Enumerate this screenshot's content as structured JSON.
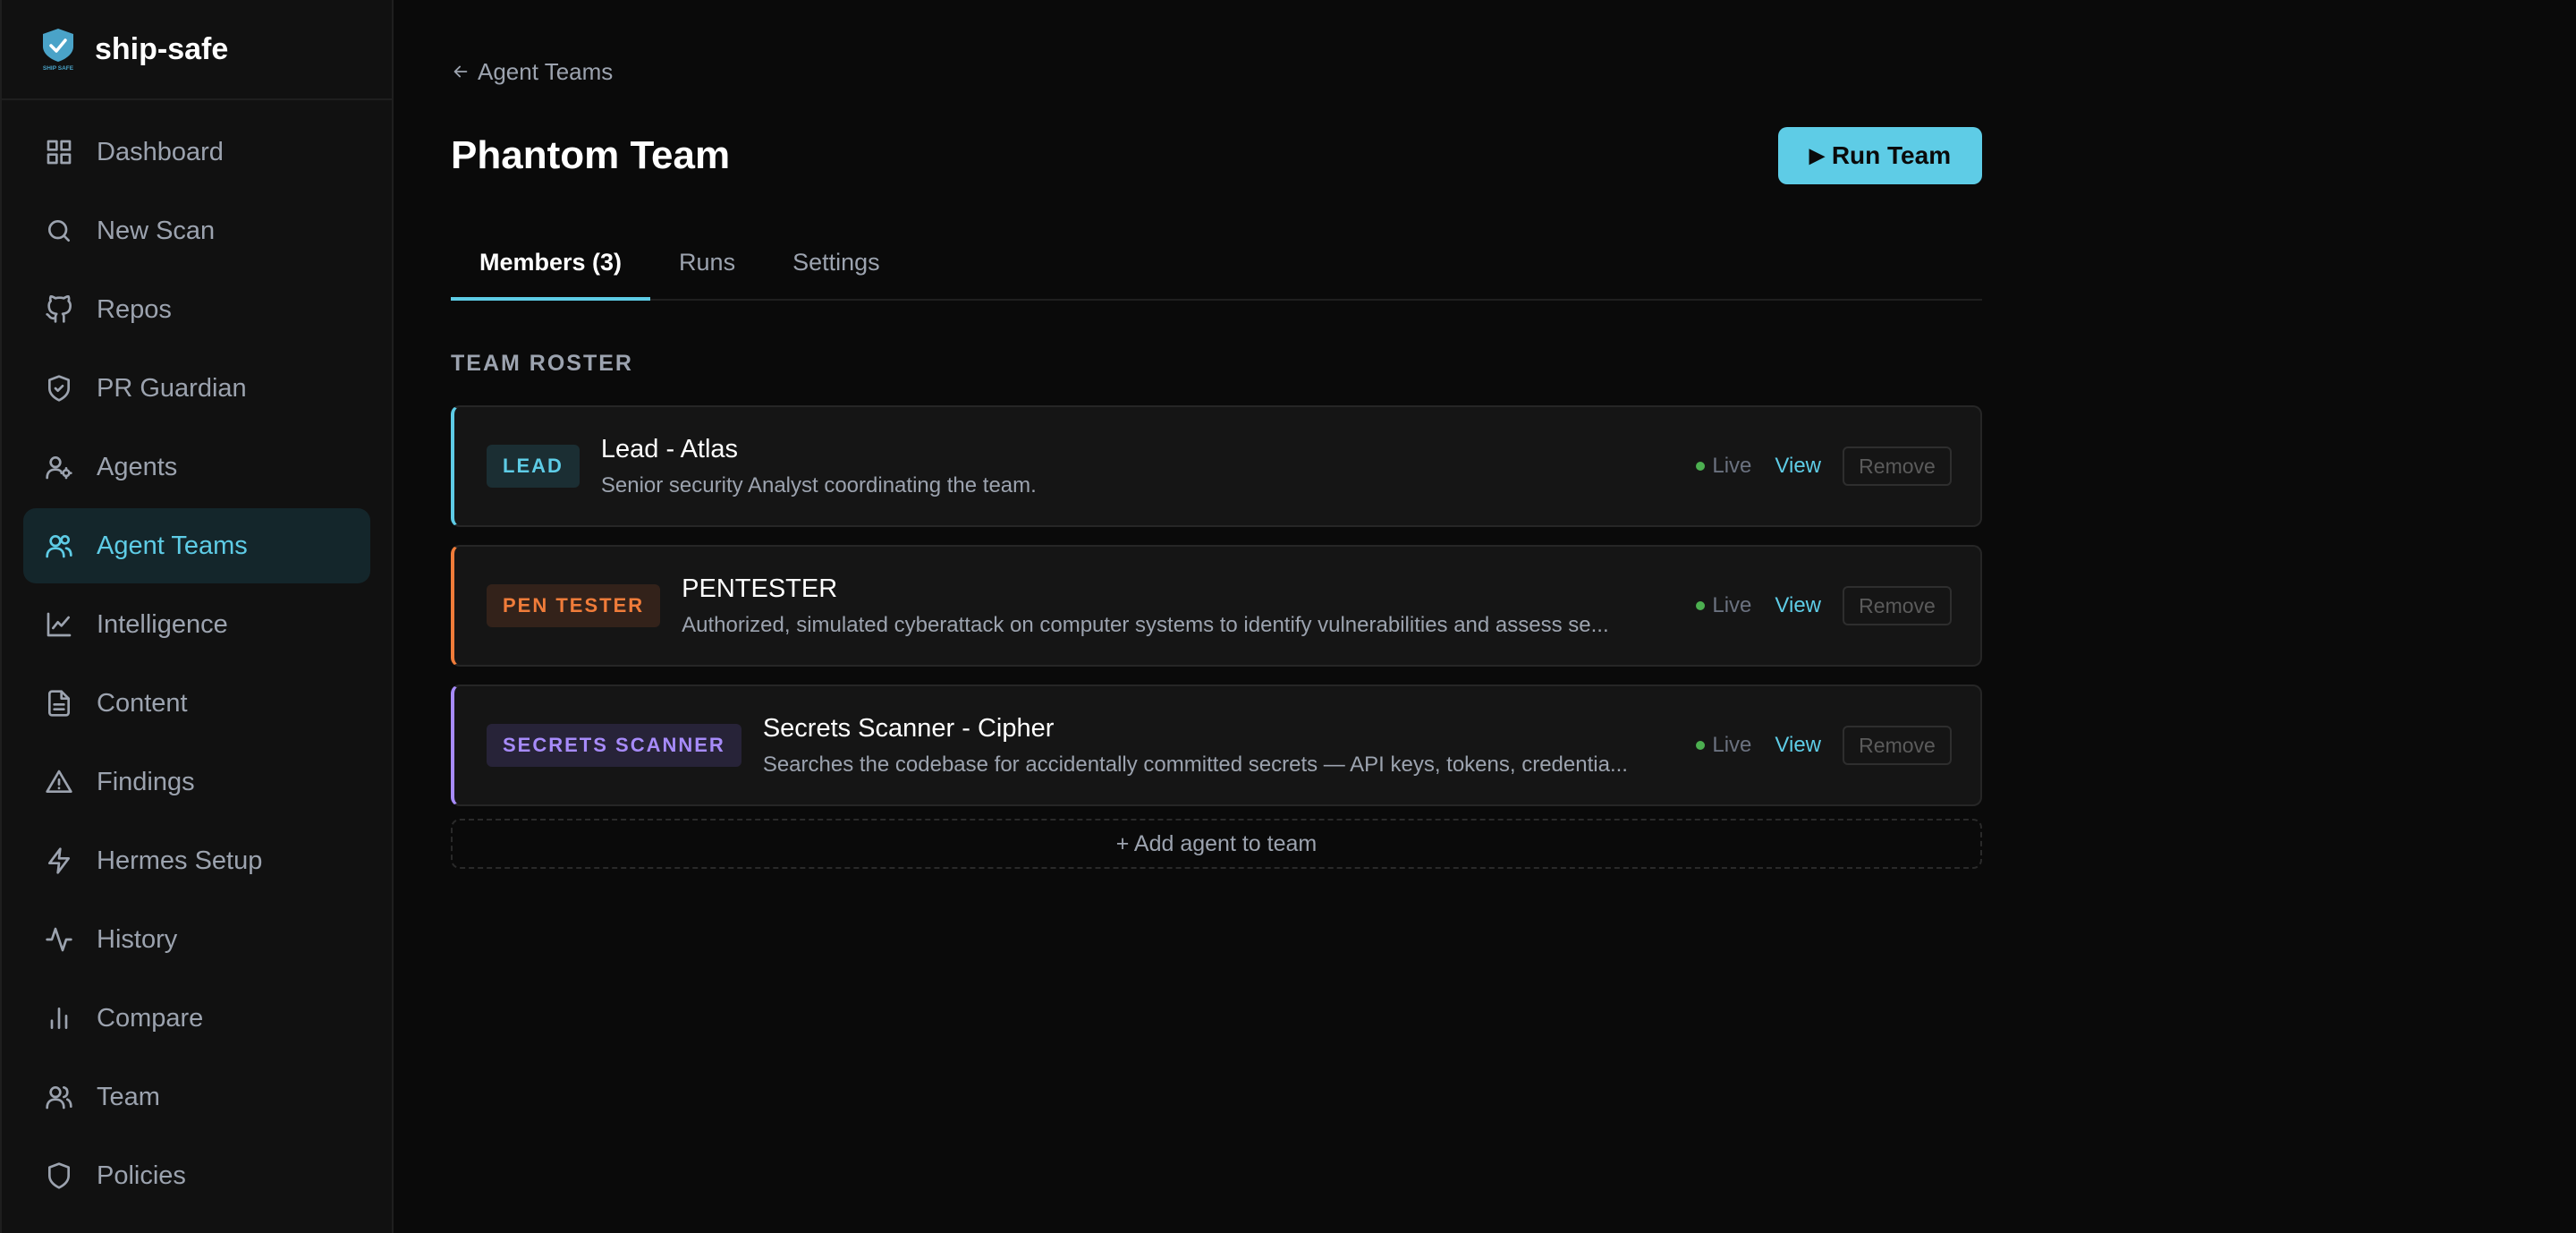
{
  "brand": {
    "name": "ship-safe",
    "logo_text": "SHIP SAFE",
    "accent": "#5ecce6"
  },
  "sidebar": {
    "items": [
      {
        "label": "Dashboard",
        "icon": "grid-icon",
        "active": false
      },
      {
        "label": "New Scan",
        "icon": "search-icon",
        "active": false
      },
      {
        "label": "Repos",
        "icon": "github-icon",
        "active": false
      },
      {
        "label": "PR Guardian",
        "icon": "shield-check-icon",
        "active": false
      },
      {
        "label": "Agents",
        "icon": "user-gear-icon",
        "active": false
      },
      {
        "label": "Agent Teams",
        "icon": "users-icon",
        "active": true
      },
      {
        "label": "Intelligence",
        "icon": "line-chart-icon",
        "active": false
      },
      {
        "label": "Content",
        "icon": "document-icon",
        "active": false
      },
      {
        "label": "Findings",
        "icon": "warning-icon",
        "active": false
      },
      {
        "label": "Hermes Setup",
        "icon": "lightning-icon",
        "active": false
      },
      {
        "label": "History",
        "icon": "activity-icon",
        "active": false
      },
      {
        "label": "Compare",
        "icon": "bar-chart-icon",
        "active": false
      },
      {
        "label": "Team",
        "icon": "team-icon",
        "active": false
      },
      {
        "label": "Policies",
        "icon": "shield-icon",
        "active": false
      }
    ]
  },
  "header": {
    "back_label": "Agent Teams",
    "title": "Phantom Team",
    "run_button": "Run Team",
    "run_icon": "▶"
  },
  "tabs": [
    {
      "label": "Members (3)",
      "active": true
    },
    {
      "label": "Runs",
      "active": false
    },
    {
      "label": "Settings",
      "active": false
    }
  ],
  "roster": {
    "section_label": "TEAM ROSTER",
    "members": [
      {
        "role": "LEAD",
        "role_color": "#5ecce6",
        "role_bg": "#1b2e33",
        "name": "Lead - Atlas",
        "description": "Senior security Analyst coordinating the team.",
        "status": "Live",
        "view_label": "View",
        "remove_label": "Remove"
      },
      {
        "role": "PEN TESTER",
        "role_color": "#f07c3a",
        "role_bg": "#33221a",
        "name": "PENTESTER",
        "description": "Authorized, simulated cyberattack on computer systems to identify vulnerabilities and assess se...",
        "status": "Live",
        "view_label": "View",
        "remove_label": "Remove"
      },
      {
        "role": "SECRETS SCANNER",
        "role_color": "#a78bfa",
        "role_bg": "#272338",
        "name": "Secrets Scanner - Cipher",
        "description": "Searches the codebase for accidentally committed secrets — API keys, tokens, credentia...",
        "status": "Live",
        "view_label": "View",
        "remove_label": "Remove"
      }
    ],
    "add_label": "+ Add agent to team"
  }
}
